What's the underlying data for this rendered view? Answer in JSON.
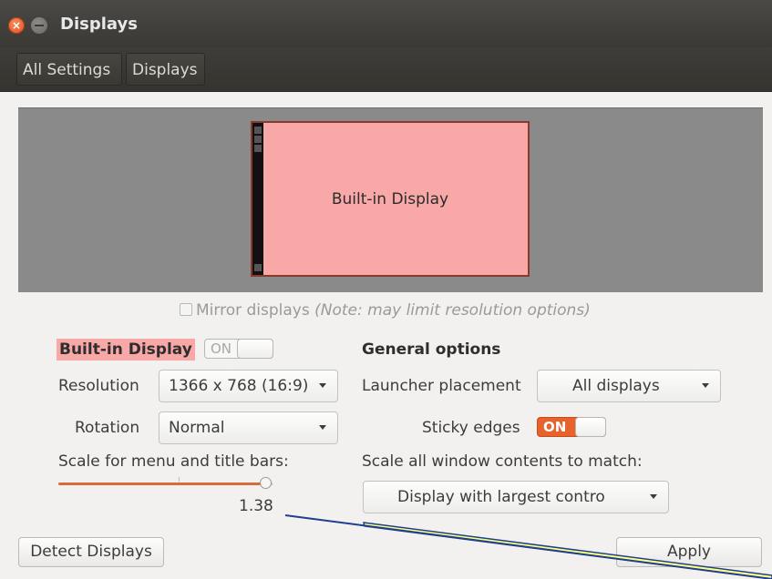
{
  "window": {
    "title": "Displays"
  },
  "toolbar": {
    "breadcrumbs": [
      "All Settings",
      "Displays"
    ]
  },
  "preview": {
    "monitor_label": "Built-in Display"
  },
  "mirror": {
    "label": "Mirror displays",
    "note": "(Note: may limit resolution options)",
    "checked": false
  },
  "display": {
    "title": "Built-in Display",
    "power_switch": "ON",
    "resolution_label": "Resolution",
    "resolution_value": "1366 x 768 (16:9)",
    "rotation_label": "Rotation",
    "rotation_value": "Normal",
    "scale_label": "Scale for menu and title bars:",
    "scale_value": "1.38"
  },
  "general": {
    "title": "General options",
    "launcher_label": "Launcher placement",
    "launcher_value": "All displays",
    "sticky_label": "Sticky edges",
    "sticky_switch": "ON",
    "scale_all_label": "Scale all window contents to match:",
    "scale_all_value": "Display with largest contro"
  },
  "buttons": {
    "detect": "Detect Displays",
    "apply": "Apply"
  },
  "colors": {
    "accent": "#e8622c",
    "monitor_fill": "#f9a8a8",
    "annotation_line": "#1f3f8f",
    "annotation_fill": "#ffff80"
  }
}
